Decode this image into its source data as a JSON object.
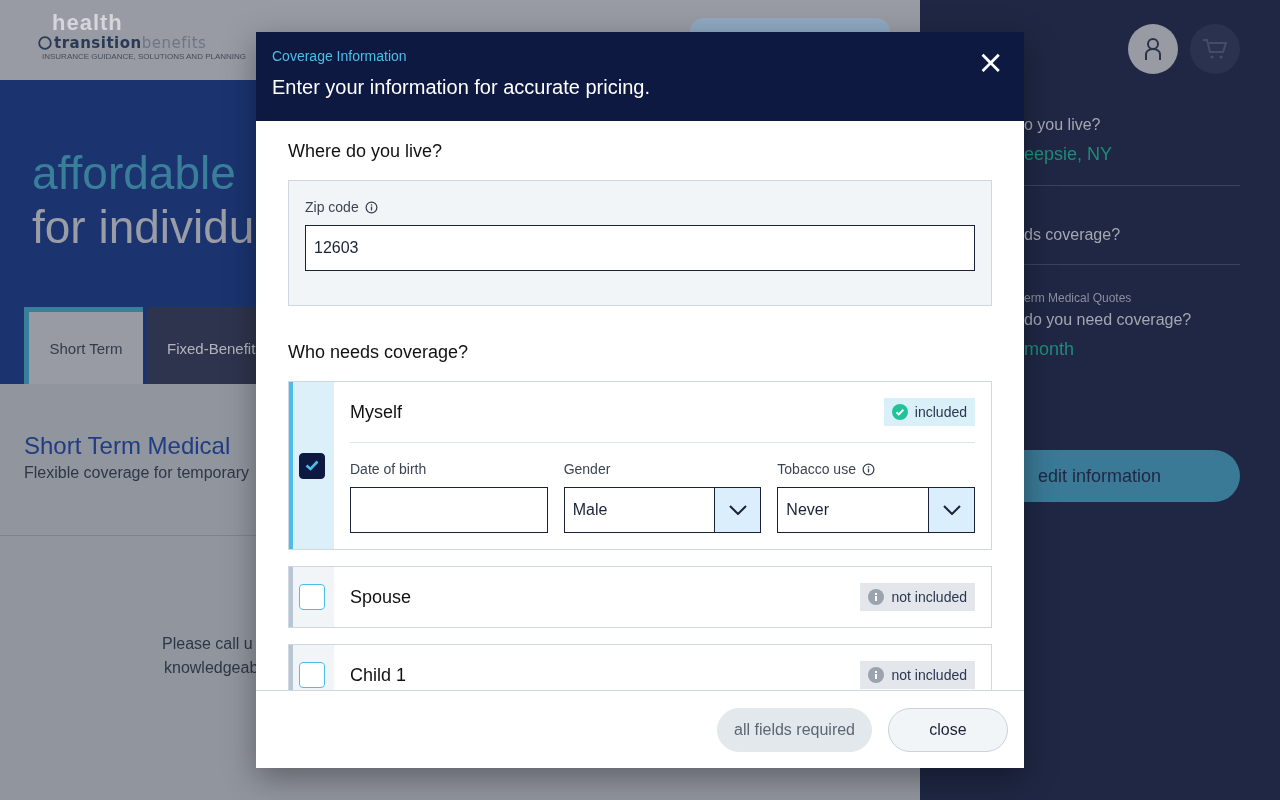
{
  "header": {
    "logo": {
      "backdrop": "health",
      "name_bold": "transition",
      "name_light": "benefits",
      "tagline": "INSURANCE GUIDANCE, SOLUTIONS AND PLANNING"
    }
  },
  "hero": {
    "line_1": "affordable",
    "line_2": "for individu"
  },
  "tabs": [
    {
      "label": "Short Term",
      "selected": true
    },
    {
      "label": "Fixed-Benefit",
      "selected": false
    }
  ],
  "product": {
    "title": "Short Term Medical",
    "subtitle": "Flexible coverage for temporary"
  },
  "contact": {
    "lines": [
      "Please call u",
      "knowledgeab"
    ]
  },
  "sidebar": {
    "sections": [
      {
        "question": "o you live?",
        "answer": "eepsie, NY"
      },
      {
        "question": "ds coverage?"
      },
      {
        "caption": "erm Medical Quotes",
        "question": "do you need coverage?",
        "answer": "month"
      }
    ],
    "button": "edit information"
  },
  "modal": {
    "kicker": "Coverage Information",
    "title": "Enter your information for accurate pricing.",
    "close": "×",
    "location": {
      "heading": "Where do you live?",
      "label": "Zip code",
      "info": true,
      "value": "12603"
    },
    "members_heading": "Who needs coverage?",
    "members": [
      {
        "name": "Myself",
        "checked": true,
        "expanded": true,
        "status": {
          "text": "included",
          "included": true
        },
        "fields": [
          {
            "kind": "text",
            "label": "Date of birth",
            "info": false
          },
          {
            "kind": "select",
            "label": "Gender",
            "info": false,
            "value": "Male"
          },
          {
            "kind": "select",
            "label": "Tobacco use",
            "info": true,
            "value": "Never"
          }
        ]
      },
      {
        "name": "Spouse",
        "checked": false,
        "expanded": false,
        "status": {
          "text": "not included",
          "included": false
        }
      },
      {
        "name": "Child 1",
        "checked": false,
        "expanded": false,
        "status": {
          "text": "not included",
          "included": false
        }
      }
    ],
    "footer": [
      {
        "label": "all fields required",
        "disabled": true
      },
      {
        "label": "close",
        "disabled": false
      }
    ]
  }
}
